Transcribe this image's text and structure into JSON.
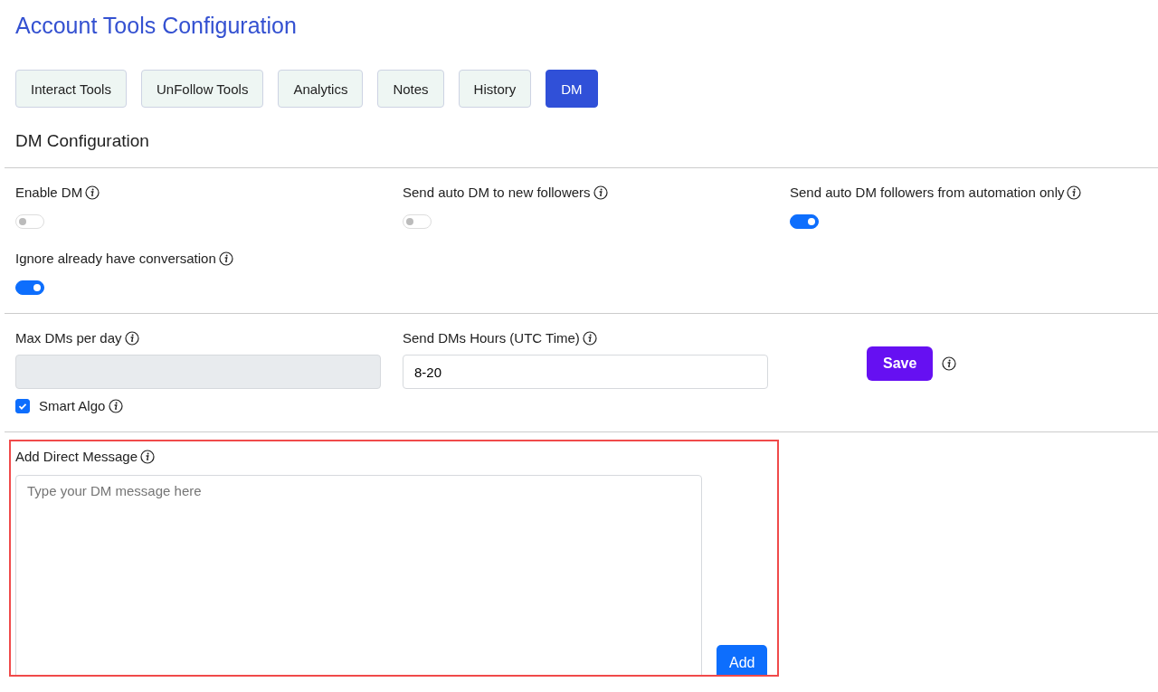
{
  "title": "Account Tools Configuration",
  "tabs": [
    {
      "label": "Interact Tools",
      "selected": false
    },
    {
      "label": "UnFollow Tools",
      "selected": false
    },
    {
      "label": "Analytics",
      "selected": false
    },
    {
      "label": "Notes",
      "selected": false
    },
    {
      "label": "History",
      "selected": false
    },
    {
      "label": "DM",
      "selected": true
    }
  ],
  "section_title": "DM Configuration",
  "toggles": [
    {
      "label": "Enable DM",
      "on": false
    },
    {
      "label": "Send auto DM to new followers",
      "on": false
    },
    {
      "label": "Send auto DM followers from automation only",
      "on": true
    },
    {
      "label": "Ignore already have conversation",
      "on": true
    }
  ],
  "max_dms": {
    "label": "Max DMs per day",
    "disabled": true,
    "checkbox": {
      "label": "Smart Algo",
      "checked": true
    }
  },
  "send_hours": {
    "label": "Send DMs Hours (UTC Time)",
    "value": "8-20"
  },
  "save_button": "Save",
  "direct_message": {
    "label": "Add Direct Message",
    "placeholder": "Type your DM message here",
    "button": "Add"
  }
}
